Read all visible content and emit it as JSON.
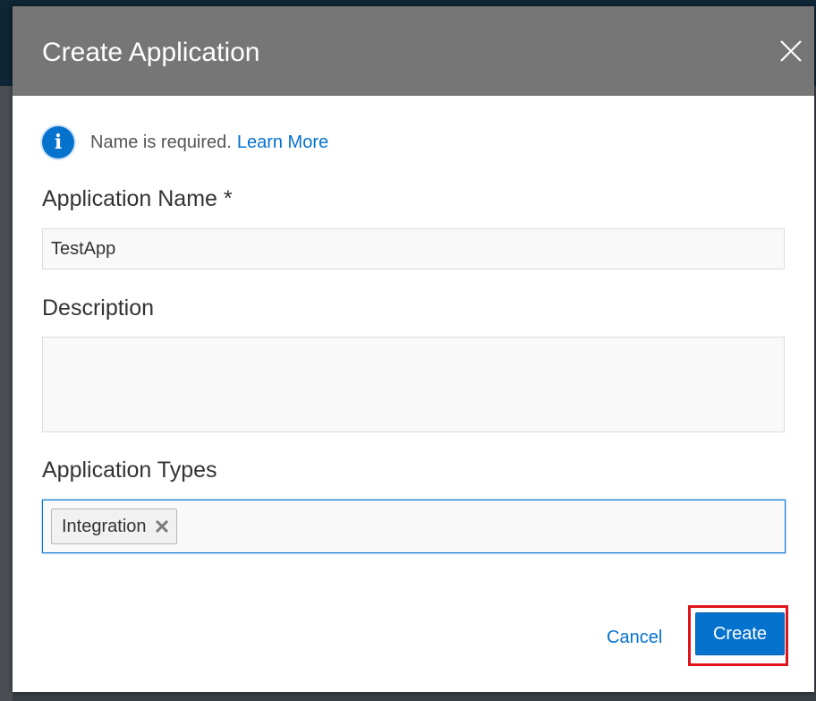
{
  "dialog": {
    "title": "Create Application",
    "close_icon": "close-icon"
  },
  "info": {
    "icon": "info-icon",
    "icon_glyph": "i",
    "message": "Name is required.",
    "link_label": "Learn More"
  },
  "form": {
    "name": {
      "label": "Application Name *",
      "value": "TestApp"
    },
    "description": {
      "label": "Description",
      "value": ""
    },
    "types": {
      "label": "Application Types",
      "selected": [
        "Integration"
      ],
      "remove_icon": "remove-x-icon"
    }
  },
  "actions": {
    "cancel_label": "Cancel",
    "create_label": "Create"
  },
  "colors": {
    "header_bg": "#767676",
    "accent": "#0572ce",
    "highlight": "#e0141c"
  }
}
